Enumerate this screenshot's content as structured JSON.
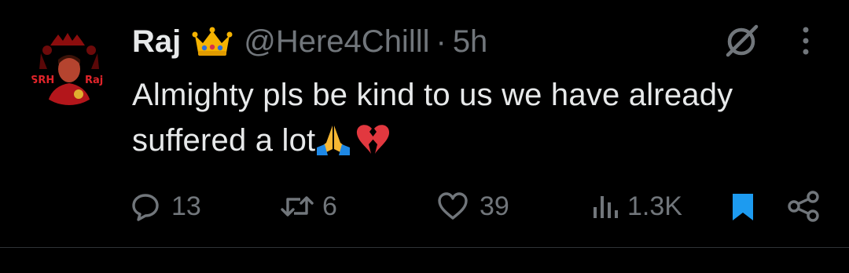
{
  "tweet": {
    "display_name": "Raj",
    "badge_emoji": "crown-emoji",
    "handle": "@Here4Chilll",
    "separator": "·",
    "timestamp": "5h",
    "text": "Almighty pls be kind to us we have already suffered a lot",
    "text_emojis": [
      "folded-hands-emoji",
      "broken-heart-emoji"
    ],
    "avatar_overlay_text": {
      "left": "SRH",
      "right": "Raj"
    }
  },
  "actions": {
    "replies": "13",
    "reposts": "6",
    "likes": "39",
    "views": "1.3K"
  },
  "icons": {
    "reply": "reply-icon",
    "repost": "repost-icon",
    "like": "heart-icon",
    "views": "views-icon",
    "bookmark": "bookmark-icon",
    "share": "share-icon",
    "grok": "grok-icon",
    "more": "more-icon"
  },
  "colors": {
    "background": "#000000",
    "primary_text": "#e7e9ea",
    "secondary_text": "#71767b",
    "bookmark_active": "#1d9bf0",
    "divider": "#2f3336"
  }
}
